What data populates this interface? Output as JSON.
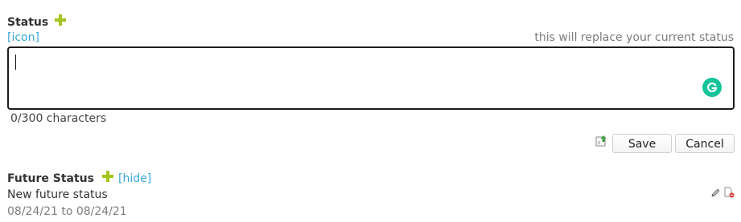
{
  "status": {
    "title": "Status",
    "icon_link": "[icon]",
    "hint": "this will replace your current status",
    "input_value": "",
    "char_counter": "0/300 characters",
    "save_label": "Save",
    "cancel_label": "Cancel"
  },
  "future_status": {
    "title": "Future Status",
    "hide_link": "[hide]",
    "entry": {
      "text": "New future status",
      "date_range": "08/24/21 to 08/24/21"
    }
  },
  "icons": {
    "add": "plus-icon",
    "grammarly": "grammarly-icon",
    "upload": "upload-icon",
    "edit": "pencil-icon",
    "delete": "delete-icon"
  },
  "colors": {
    "accent_green": "#a3c51c",
    "link_blue": "#3aa7d6",
    "grammarly_green": "#15c39a"
  }
}
